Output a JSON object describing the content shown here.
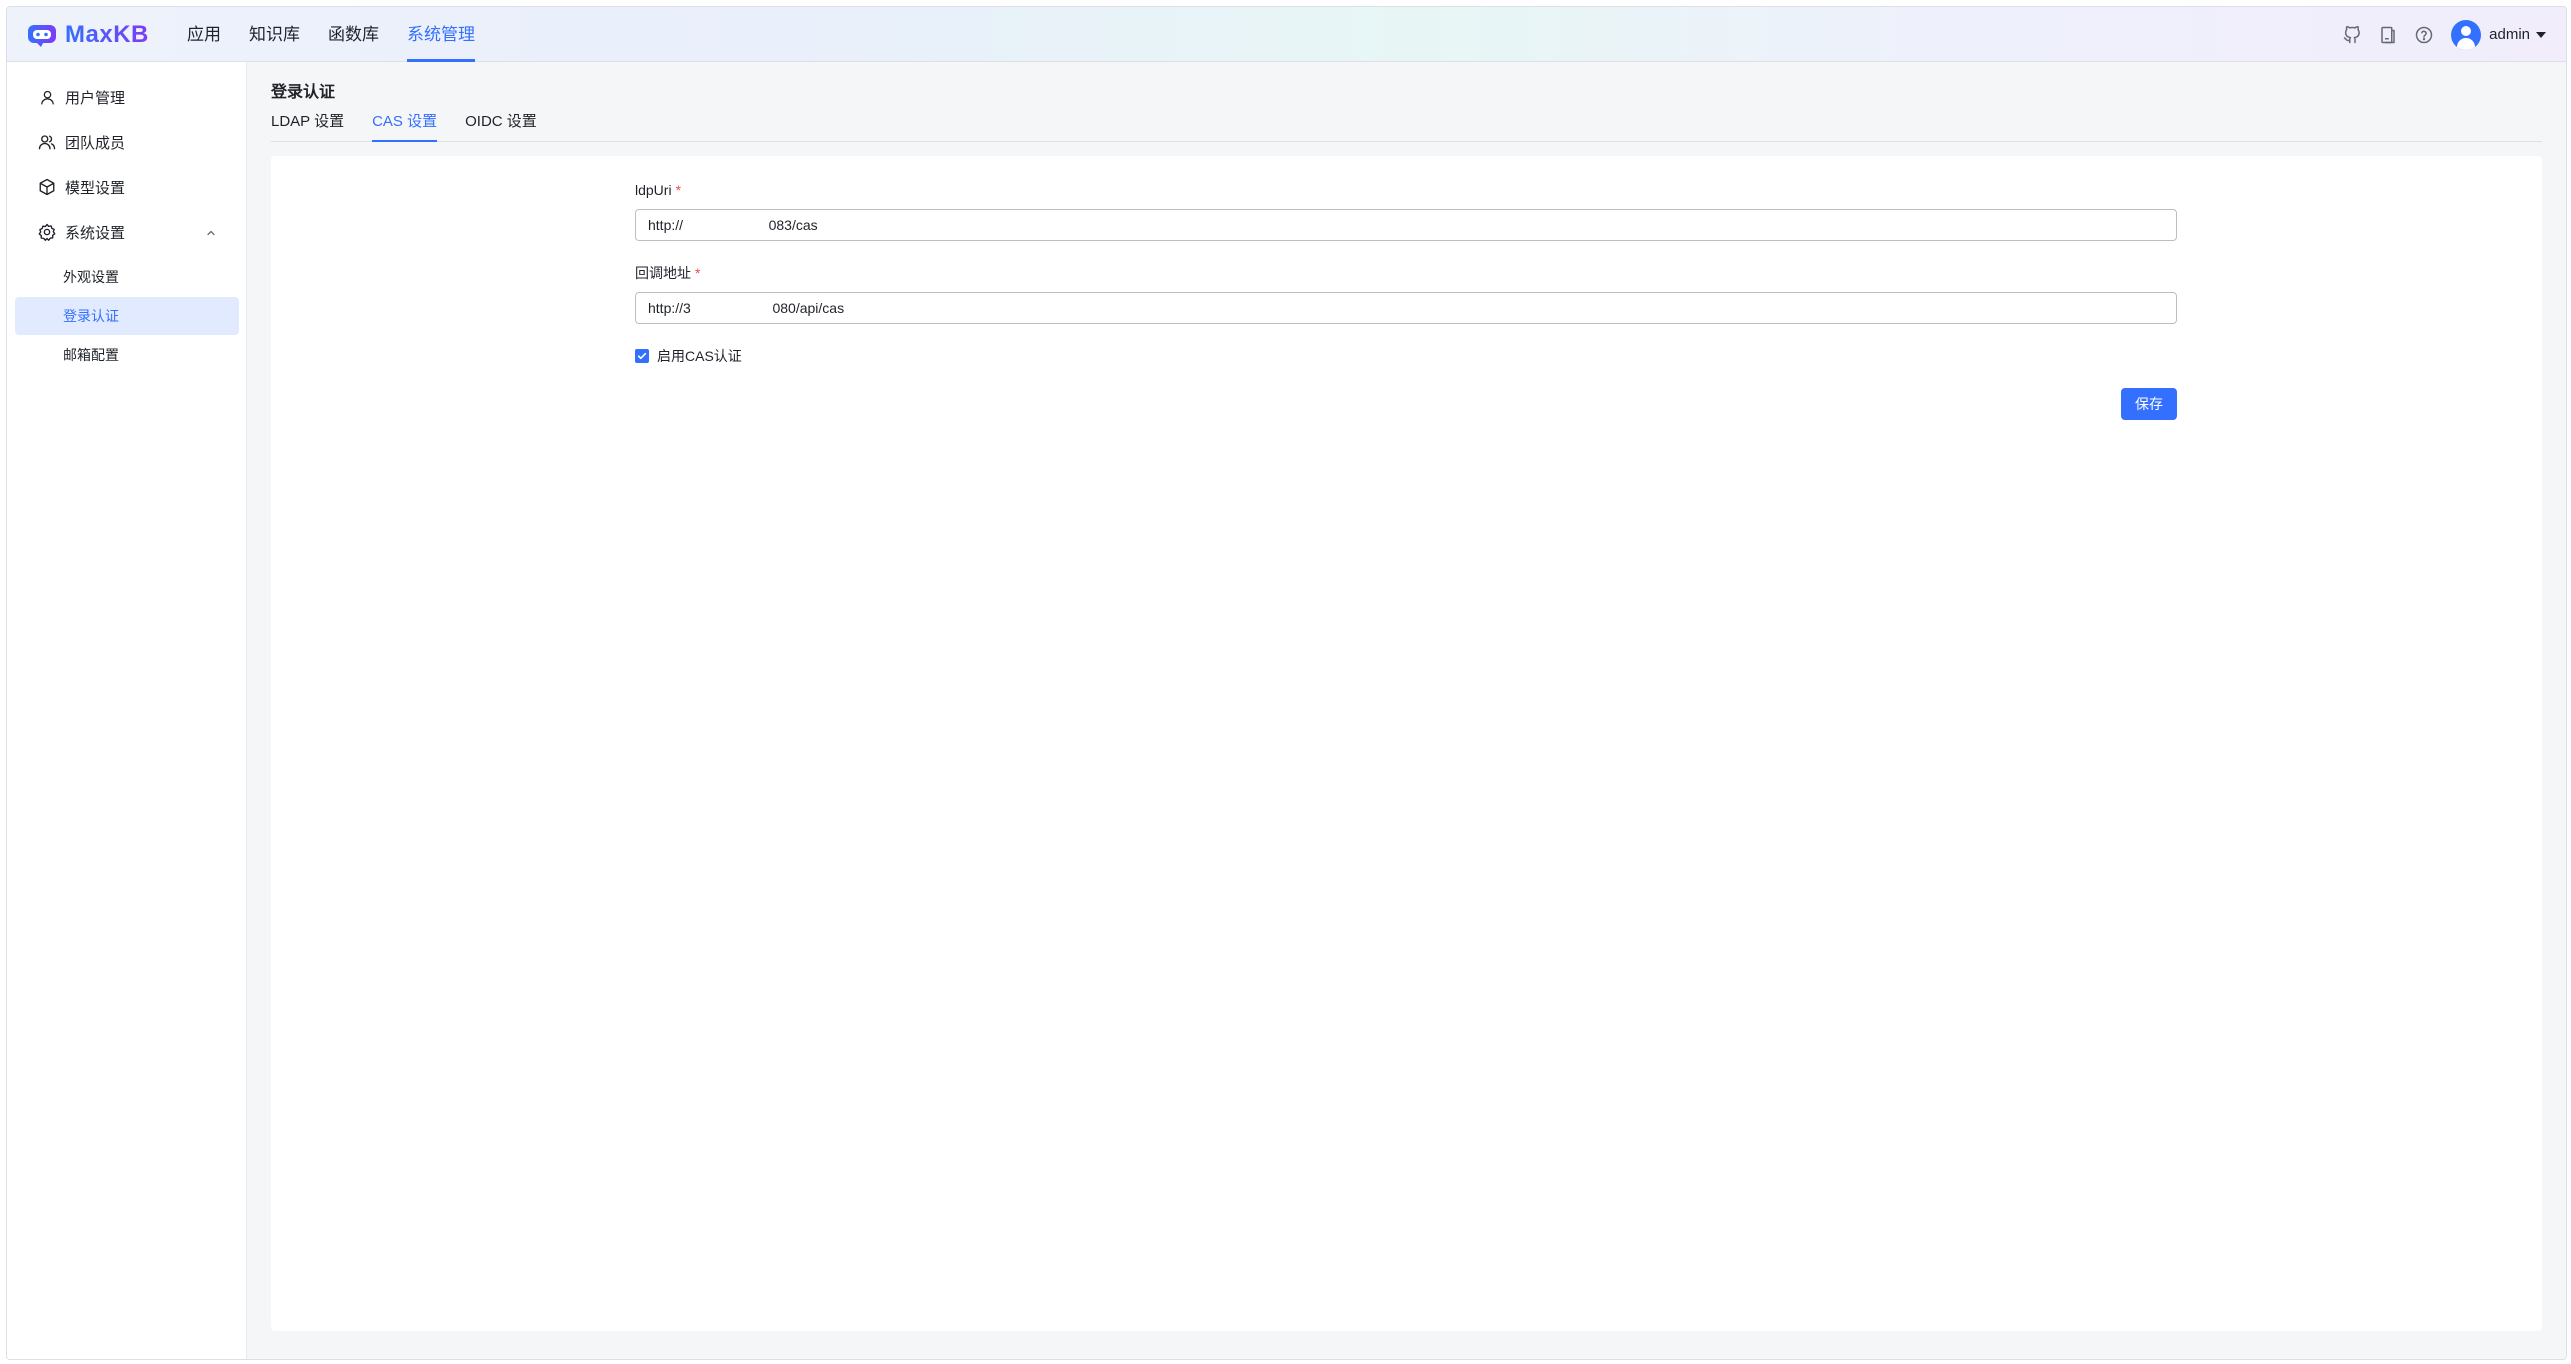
{
  "app": {
    "brand": "MaxKB",
    "nav": [
      {
        "label": "应用",
        "active": false
      },
      {
        "label": "知识库",
        "active": false
      },
      {
        "label": "函数库",
        "active": false
      },
      {
        "label": "系统管理",
        "active": true
      }
    ],
    "toolbar_icons": [
      "github-icon",
      "document-icon",
      "help-icon"
    ],
    "user": {
      "name": "admin"
    },
    "accent_color": "#3370ff"
  },
  "sidebar": {
    "items": [
      {
        "label": "用户管理",
        "icon": "user-icon"
      },
      {
        "label": "团队成员",
        "icon": "team-icon"
      },
      {
        "label": "模型设置",
        "icon": "cube-icon"
      },
      {
        "label": "系统设置",
        "icon": "gear-icon",
        "expanded": true
      }
    ],
    "sub_items": [
      {
        "label": "外观设置",
        "active": false
      },
      {
        "label": "登录认证",
        "active": true
      },
      {
        "label": "邮箱配置",
        "active": false
      }
    ]
  },
  "page": {
    "title": "登录认证",
    "tabs": [
      {
        "label": "LDAP 设置",
        "active": false
      },
      {
        "label": "CAS 设置",
        "active": true
      },
      {
        "label": "OIDC 设置",
        "active": false
      }
    ]
  },
  "form": {
    "ldp_uri": {
      "label": "ldpUri",
      "value": "http://                      083/cas"
    },
    "callback": {
      "label": "回调地址",
      "value": "http://3                     080/api/cas"
    },
    "enable_cas": {
      "label": "启用CAS认证",
      "checked": true
    },
    "save_label": "保存"
  }
}
